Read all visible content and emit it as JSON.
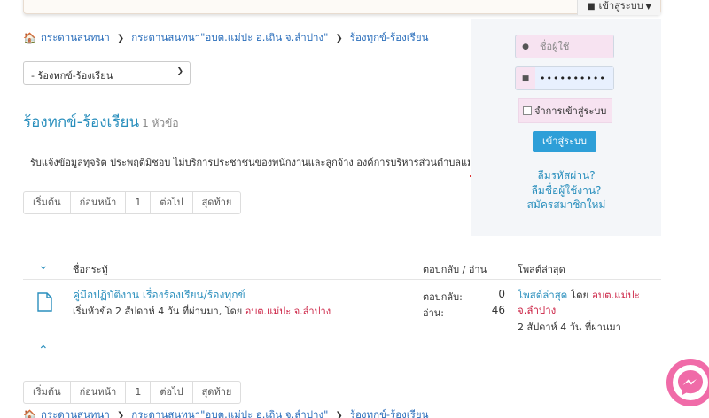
{
  "header": {
    "login_toggle": "เข้าสู่ระบบ"
  },
  "breadcrumb": {
    "items": [
      "กระดานสนทนา",
      "กระดานสนทนา\"อบต.แม่ปะ อ.เถิน จ.ลำปาง\"",
      "ร้องทุกข์-ร้องเรียน"
    ]
  },
  "category_select": {
    "value": "- ร้องทกข์-ร้องเรียน"
  },
  "category": {
    "title": "ร้องทกข์-ร้องเรียน",
    "topic_count": "1 หัวข้อ",
    "description": "รับแจ้งข้อมูลทุจริต ประพฤติมิชอบ ไม่บริการประชาชนของพนักงานและลูกจ้าง องค์การบริหารส่วนตำบลแม่ปะ"
  },
  "pagination": {
    "items": [
      "เริ่มต้น",
      "ก่อนหน้า",
      "1",
      "ต่อไป",
      "สุดท้าย"
    ]
  },
  "login": {
    "username_placeholder": "ชื่อผู้ใช้",
    "password_mask": "••••••••••",
    "remember_label": "จำการเข้าสู่ระบบ",
    "login_button": "เข้าสู่ระบบ",
    "forgot_password": "ลืมรหัสผ่าน?",
    "forgot_username": "ลืมชื่อผู้ใช้งาน?",
    "register": "สมัครสมาชิกใหม่"
  },
  "table": {
    "col_topic": "ชื่อกระทู้",
    "col_stats": "ตอบกลับ / อ่าน",
    "col_last": "โพสต์ล่าสุด",
    "rows": [
      {
        "title": "คู่มือปฏิบัติงาน เรื่องร้องเรียน/ร้องทุกข์",
        "meta_prefix": "เริ่มหัวข้อ 2 สัปดาห์ 4 วัน ที่ผ่านมา, โดย ",
        "author": "อบต.แม่ปะ จ.ลำปาง",
        "replies_label": "ตอบกลับ:",
        "replies": "0",
        "reads_label": "อ่าน:",
        "reads": "46",
        "last_post_label": "โพสต์ล่าสุด",
        "last_post_by": "โดย",
        "last_author_1": "อบต.แม่ปะ",
        "last_author_2": "จ.ลำปาง",
        "last_time": "2 สัปดาห์ 4 วัน ที่ผ่านมา"
      }
    ]
  },
  "colors": {
    "accent": "#2a8fbd",
    "author": "#cc2244",
    "login_button": "#2e9fd8",
    "messenger": "#f06ba8"
  }
}
